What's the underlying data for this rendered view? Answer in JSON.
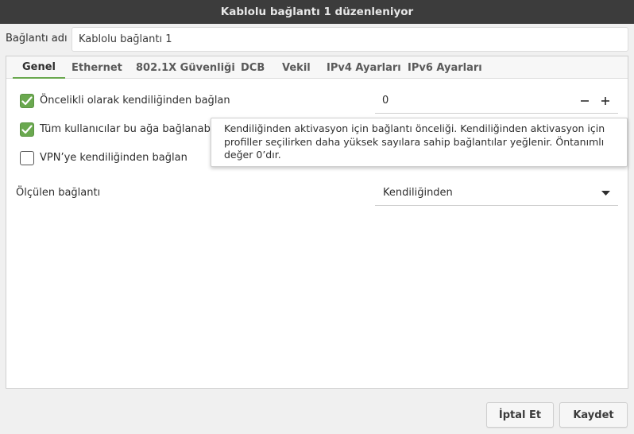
{
  "window": {
    "title": "Kablolu bağlantı 1 düzenleniyor"
  },
  "connection_name": {
    "label": "Bağlantı adı",
    "value": "Kablolu bağlantı 1"
  },
  "tabs": [
    {
      "label": "Genel",
      "active": true
    },
    {
      "label": "Ethernet",
      "active": false
    },
    {
      "label": "802.1X Güvenliği",
      "active": false
    },
    {
      "label": "DCB",
      "active": false
    },
    {
      "label": "Vekil",
      "active": false
    },
    {
      "label": "IPv4 Ayarları",
      "active": false
    },
    {
      "label": "IPv6 Ayarları",
      "active": false
    }
  ],
  "general": {
    "auto_connect": {
      "label": "Öncelikli olarak kendiliğinden bağlan",
      "checked": true
    },
    "priority": {
      "value": "0",
      "decrement_icon": "minus-icon",
      "increment_icon": "plus-icon"
    },
    "all_users": {
      "label": "Tüm kullanıcılar bu ağa bağlanabilir",
      "checked": true
    },
    "vpn_auto": {
      "label": "VPN’ye kendiliğinden bağlan",
      "checked": false
    },
    "metered": {
      "label": "Ölçülen bağlantı",
      "value": "Kendiliğinden",
      "arrow_icon": "chevron-down-icon"
    }
  },
  "tooltip": {
    "text": "Kendiliğinden aktivasyon için bağlantı önceliği. Kendiliğinden aktivasyon için profiller seçilirken daha yüksek sayılara sahip bağlantılar yeğlenir. Öntanımlı değer 0’dır."
  },
  "buttons": {
    "cancel": "İptal Et",
    "save": "Kaydet"
  },
  "colors": {
    "accent": "#6aa84f",
    "titlebar": "#3c3c3c",
    "titlebar_text": "#e8e8e8",
    "background": "#f0f0f0",
    "panel": "#ffffff"
  }
}
